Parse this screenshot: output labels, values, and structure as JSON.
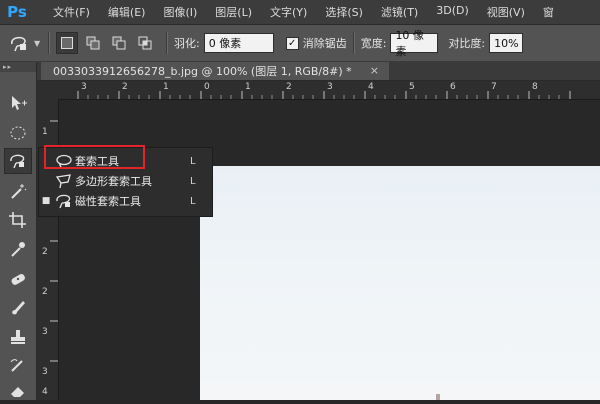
{
  "app": {
    "logo": "Ps"
  },
  "menu": [
    "文件(F)",
    "编辑(E)",
    "图像(I)",
    "图层(L)",
    "文字(Y)",
    "选择(S)",
    "滤镜(T)",
    "3D(D)",
    "视图(V)",
    "窗"
  ],
  "options": {
    "feather_label": "羽化:",
    "feather_value": "0 像素",
    "antialias_label": "消除锯齿",
    "antialias_checked": "✓",
    "width_label": "宽度:",
    "width_value": "10 像素",
    "contrast_label": "对比度:",
    "contrast_value": "10%"
  },
  "document": {
    "tab_title": "0033033912656278_b.jpg @ 100% (图层 1, RGB/8#) *",
    "close": "×"
  },
  "rulers": {
    "horizontal": [
      "3",
      "2",
      "1",
      "0",
      "1",
      "2",
      "3",
      "4",
      "5",
      "6",
      "7",
      "8"
    ],
    "vertical": [
      "1",
      "1",
      "2",
      "2",
      "3",
      "3",
      "4"
    ]
  },
  "flyout": {
    "items": [
      {
        "label": "套索工具",
        "key": "L",
        "selected": false,
        "icon": "lasso-icon"
      },
      {
        "label": "多边形套索工具",
        "key": "L",
        "selected": false,
        "icon": "polygonal-lasso-icon"
      },
      {
        "label": "磁性套索工具",
        "key": "L",
        "selected": true,
        "icon": "magnetic-lasso-icon"
      }
    ],
    "current_marker": "■"
  },
  "colors": {
    "highlight_box": "#e3252b",
    "ps_logo": "#31a8ff"
  }
}
